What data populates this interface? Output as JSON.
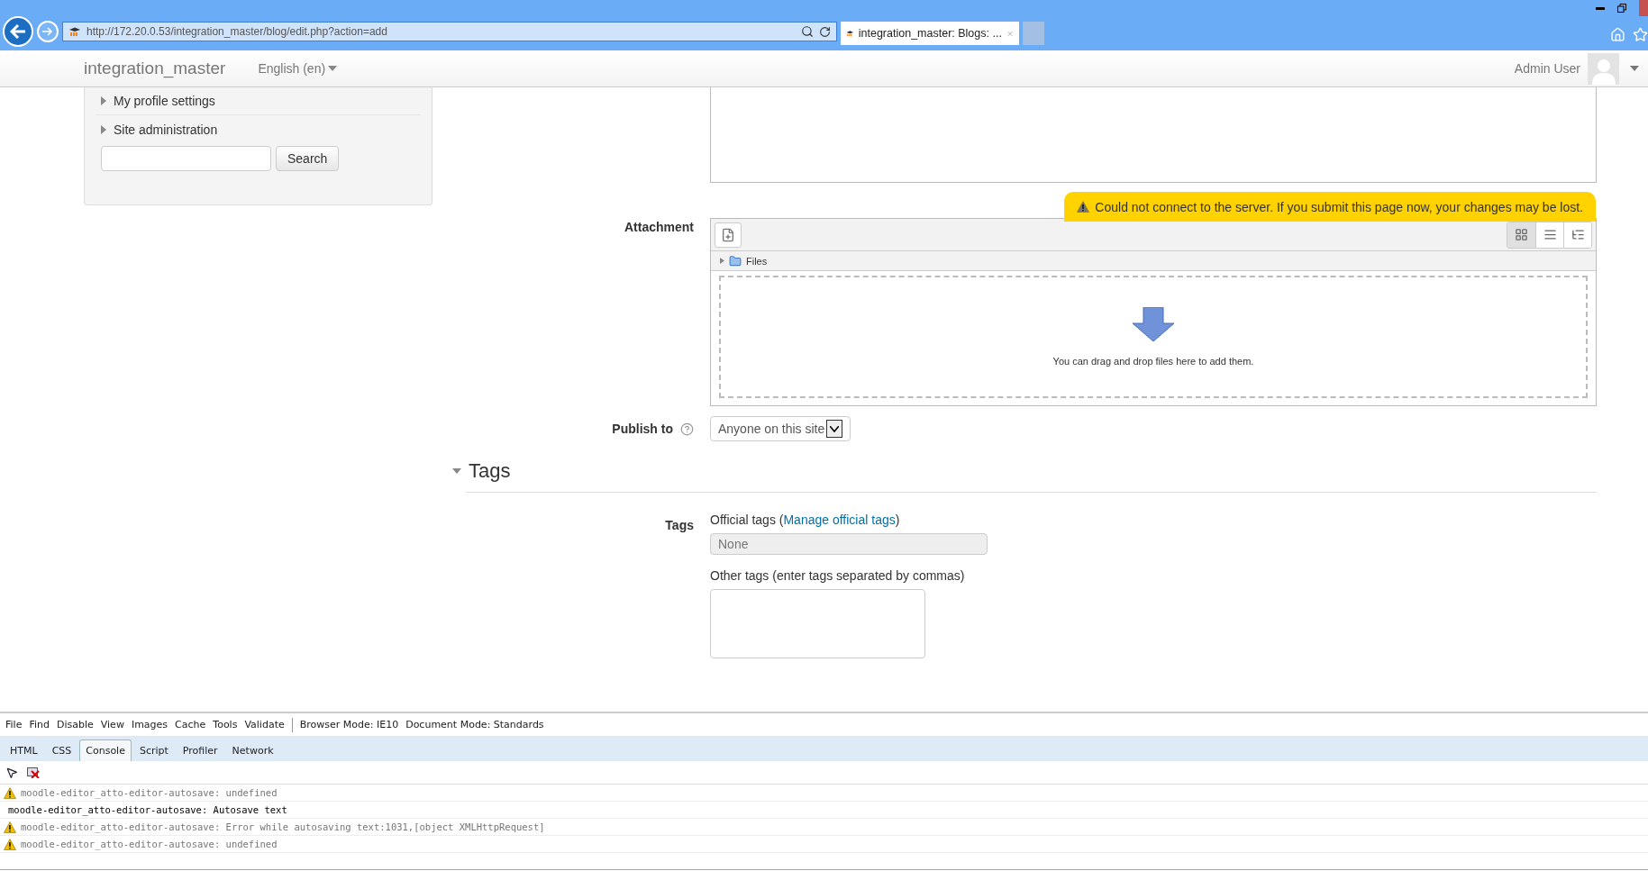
{
  "browser": {
    "address": "http://172.20.0.53/integration_master/blog/edit.php?action=add",
    "tab_title": "integration_master: Blogs: ..."
  },
  "navbar": {
    "brand": "integration_master",
    "language": "English (en)",
    "user": "Admin User"
  },
  "sidebar": {
    "items": [
      {
        "label": "My profile settings",
        "expanded": false
      },
      {
        "label": "Site administration",
        "expanded": false
      }
    ],
    "search_button": "Search"
  },
  "form": {
    "warning": "Could not connect to the server. If you submit this page now, your changes may be lost.",
    "attachment": {
      "label": "Attachment",
      "folder": "Files",
      "drop_hint": "You can drag and drop files here to add them.",
      "view_modes": [
        {
          "kind": "icons",
          "selected": true
        },
        {
          "kind": "list",
          "selected": false
        },
        {
          "kind": "tree",
          "selected": false
        }
      ]
    },
    "publish": {
      "label": "Publish to",
      "value": "Anyone on this site"
    },
    "tags_section": {
      "title": "Tags",
      "expanded": true
    },
    "tags": {
      "label": "Tags",
      "official_prefix": "Official tags (",
      "official_link": "Manage official tags",
      "official_suffix": ")",
      "official_value": "None",
      "other_label": "Other tags (enter tags separated by commas)"
    }
  },
  "devtools": {
    "menu": [
      "File",
      "Find",
      "Disable",
      "View",
      "Images",
      "Cache",
      "Tools",
      "Validate"
    ],
    "browser_mode": "Browser Mode: IE10",
    "document_mode": "Document Mode:  Standards",
    "tabs": [
      {
        "label": "HTML",
        "selected": false
      },
      {
        "label": "CSS",
        "selected": false
      },
      {
        "label": "Console",
        "selected": true
      },
      {
        "label": "Script",
        "selected": false
      },
      {
        "label": "Profiler",
        "selected": false
      },
      {
        "label": "Network",
        "selected": false
      }
    ],
    "console": [
      {
        "kind": "warning",
        "text": "moodle-editor_atto-editor-autosave: undefined"
      },
      {
        "kind": "log",
        "text": "moodle-editor_atto-editor-autosave: Autosave text"
      },
      {
        "kind": "warning",
        "text": "moodle-editor_atto-editor-autosave: Error while autosaving text:1031,[object XMLHttpRequest]"
      },
      {
        "kind": "warning",
        "text": "moodle-editor_atto-editor-autosave: undefined"
      }
    ]
  }
}
